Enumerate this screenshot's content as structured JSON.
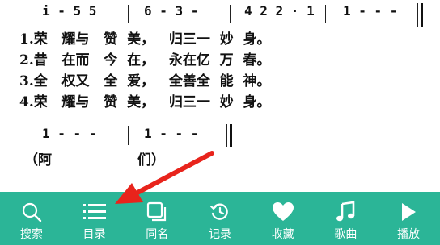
{
  "score": {
    "notation_row1": {
      "segments": [
        "i - 5 5",
        "6 - 3 -",
        "4 2 2 · 1",
        "1 - - -"
      ]
    },
    "lyrics": [
      "1.荣   耀与   赞  美，   归三一  妙  身。",
      "2.昔   在而   今  在，   永在亿  万  春。",
      "3.全   权又   全  爱，   全善全  能  神。",
      "4.荣   耀与   赞  美，   归三一  妙  身。"
    ],
    "notation_row2": {
      "segments": [
        "1 - - -",
        "1 - - -"
      ]
    },
    "amen": {
      "open": "（阿",
      "close": "们）"
    }
  },
  "toolbar": {
    "background": "#2bb597",
    "items": [
      {
        "id": "search",
        "label": "搜索",
        "icon": "search-icon"
      },
      {
        "id": "contents",
        "label": "目录",
        "icon": "list-icon"
      },
      {
        "id": "same-name",
        "label": "同名",
        "icon": "copy-icon"
      },
      {
        "id": "history",
        "label": "记录",
        "icon": "history-icon"
      },
      {
        "id": "favorite",
        "label": "收藏",
        "icon": "heart-icon"
      },
      {
        "id": "songs",
        "label": "歌曲",
        "icon": "music-note-icon"
      },
      {
        "id": "play",
        "label": "播放",
        "icon": "play-icon"
      }
    ]
  },
  "annotation": {
    "arrow_color": "#e8241c"
  }
}
